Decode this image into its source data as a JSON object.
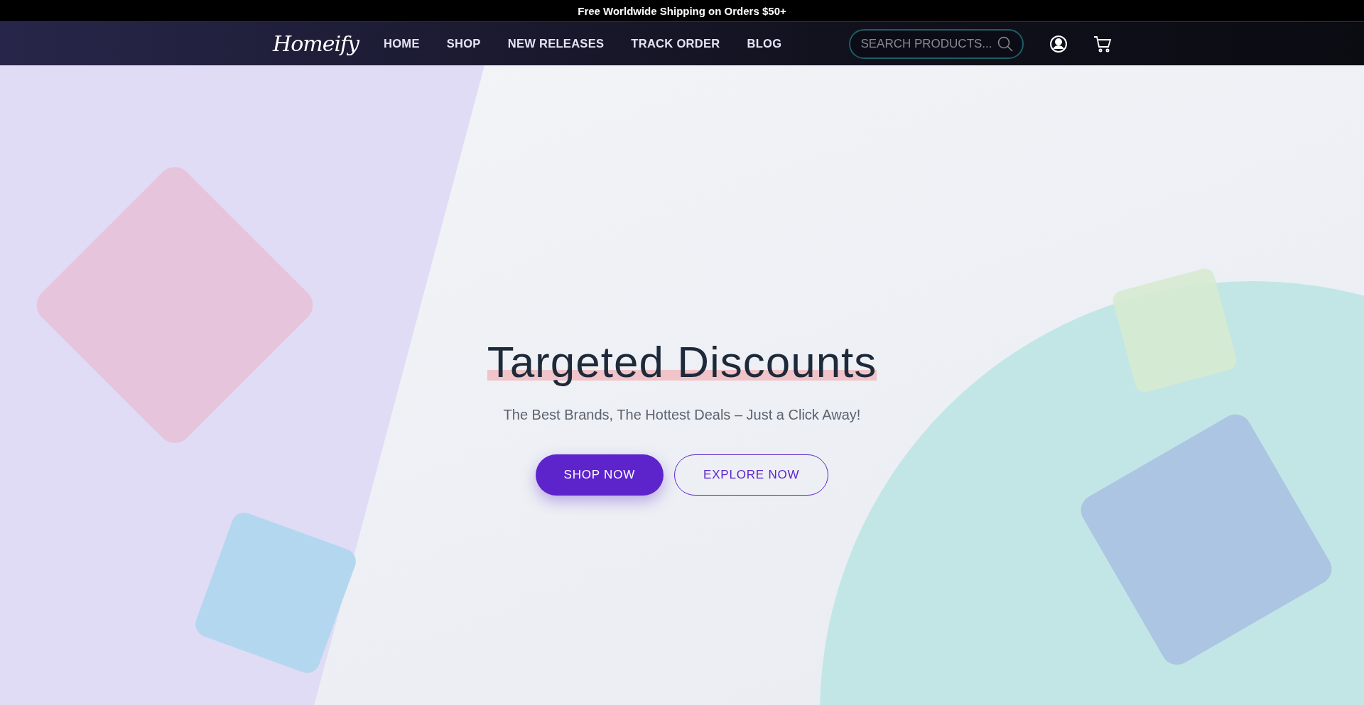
{
  "announcement": "Free Worldwide Shipping on Orders $50+",
  "header": {
    "logo": "Homeify",
    "nav": [
      {
        "label": "HOME"
      },
      {
        "label": "SHOP"
      },
      {
        "label": "NEW RELEASES"
      },
      {
        "label": "TRACK ORDER"
      },
      {
        "label": "BLOG"
      }
    ],
    "search": {
      "placeholder": "SEARCH PRODUCTS..."
    }
  },
  "hero": {
    "title": "Targeted Discounts",
    "subtitle": "The Best Brands, The Hottest Deals – Just a Click Away!",
    "buttons": [
      {
        "label": "SHOP NOW",
        "kind": "primary"
      },
      {
        "label": "EXPLORE NOW",
        "kind": "outline"
      }
    ]
  }
}
